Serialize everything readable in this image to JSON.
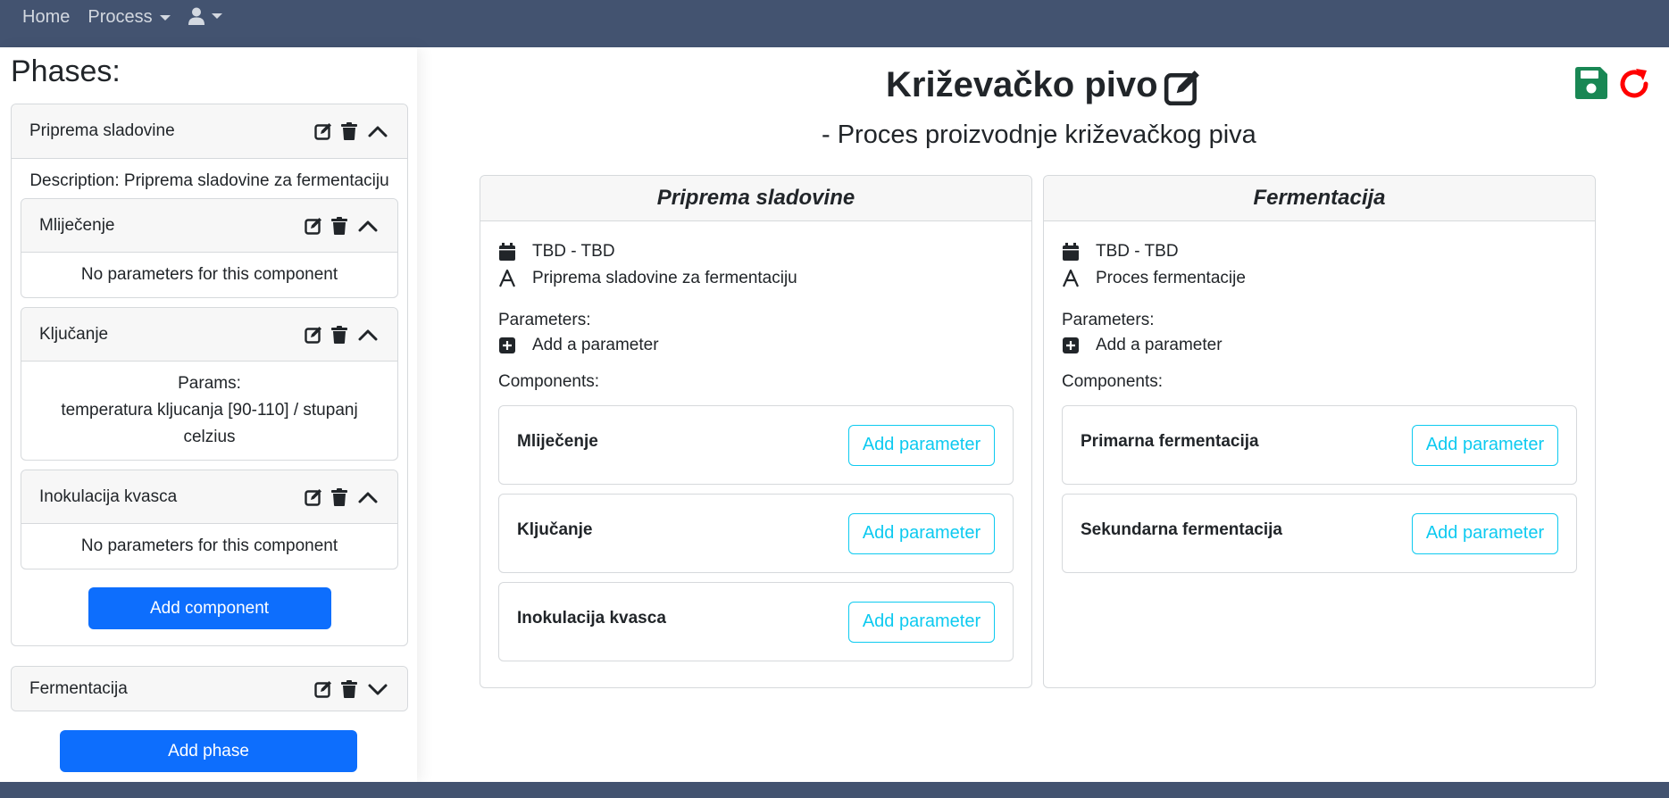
{
  "nav": {
    "home": "Home",
    "process": "Process"
  },
  "sidebar": {
    "title": "Phases:",
    "phases": [
      {
        "name": "Priprema sladovine",
        "description": "Description: Priprema sladovine za fermentaciju",
        "components": [
          {
            "name": "Mliječenje",
            "body": "No parameters for this component"
          },
          {
            "name": "Ključanje",
            "params_label": "Params:",
            "params_value": "temperatura kljucanja [90-110] / stupanj celzius"
          },
          {
            "name": "Inokulacija kvasca",
            "body": "No parameters for this component"
          }
        ],
        "add_component": "Add component"
      },
      {
        "name": "Fermentacija"
      }
    ],
    "add_phase": "Add phase"
  },
  "main": {
    "title": "Križevačko pivo",
    "subtitle": "- Proces proizvodnje križevačkog piva",
    "phases": [
      {
        "title": "Priprema sladovine",
        "dates": "TBD - TBD",
        "description": "Priprema sladovine za fermentaciju",
        "parameters_label": "Parameters:",
        "add_parameter": "Add a parameter",
        "components_label": "Components:",
        "components": [
          "Mliječenje",
          "Ključanje",
          "Inokulacija kvasca"
        ],
        "component_button": "Add parameter"
      },
      {
        "title": "Fermentacija",
        "dates": "TBD - TBD",
        "description": "Proces fermentacije",
        "parameters_label": "Parameters:",
        "add_parameter": "Add a parameter",
        "components_label": "Components:",
        "components": [
          "Primarna fermentacija",
          "Sekundarna fermentacija"
        ],
        "component_button": "Add parameter"
      }
    ]
  },
  "colors": {
    "navbar": "#435370",
    "primary": "#0d6efd",
    "info": "#0dcaf0",
    "save": "#198754",
    "undo": "#ff0000"
  },
  "icons": [
    "user-icon",
    "edit-icon",
    "trash-icon",
    "chevron-up-icon",
    "chevron-down-icon",
    "save-icon",
    "undo-icon",
    "calendar-icon",
    "font-icon",
    "plus-square-icon"
  ]
}
